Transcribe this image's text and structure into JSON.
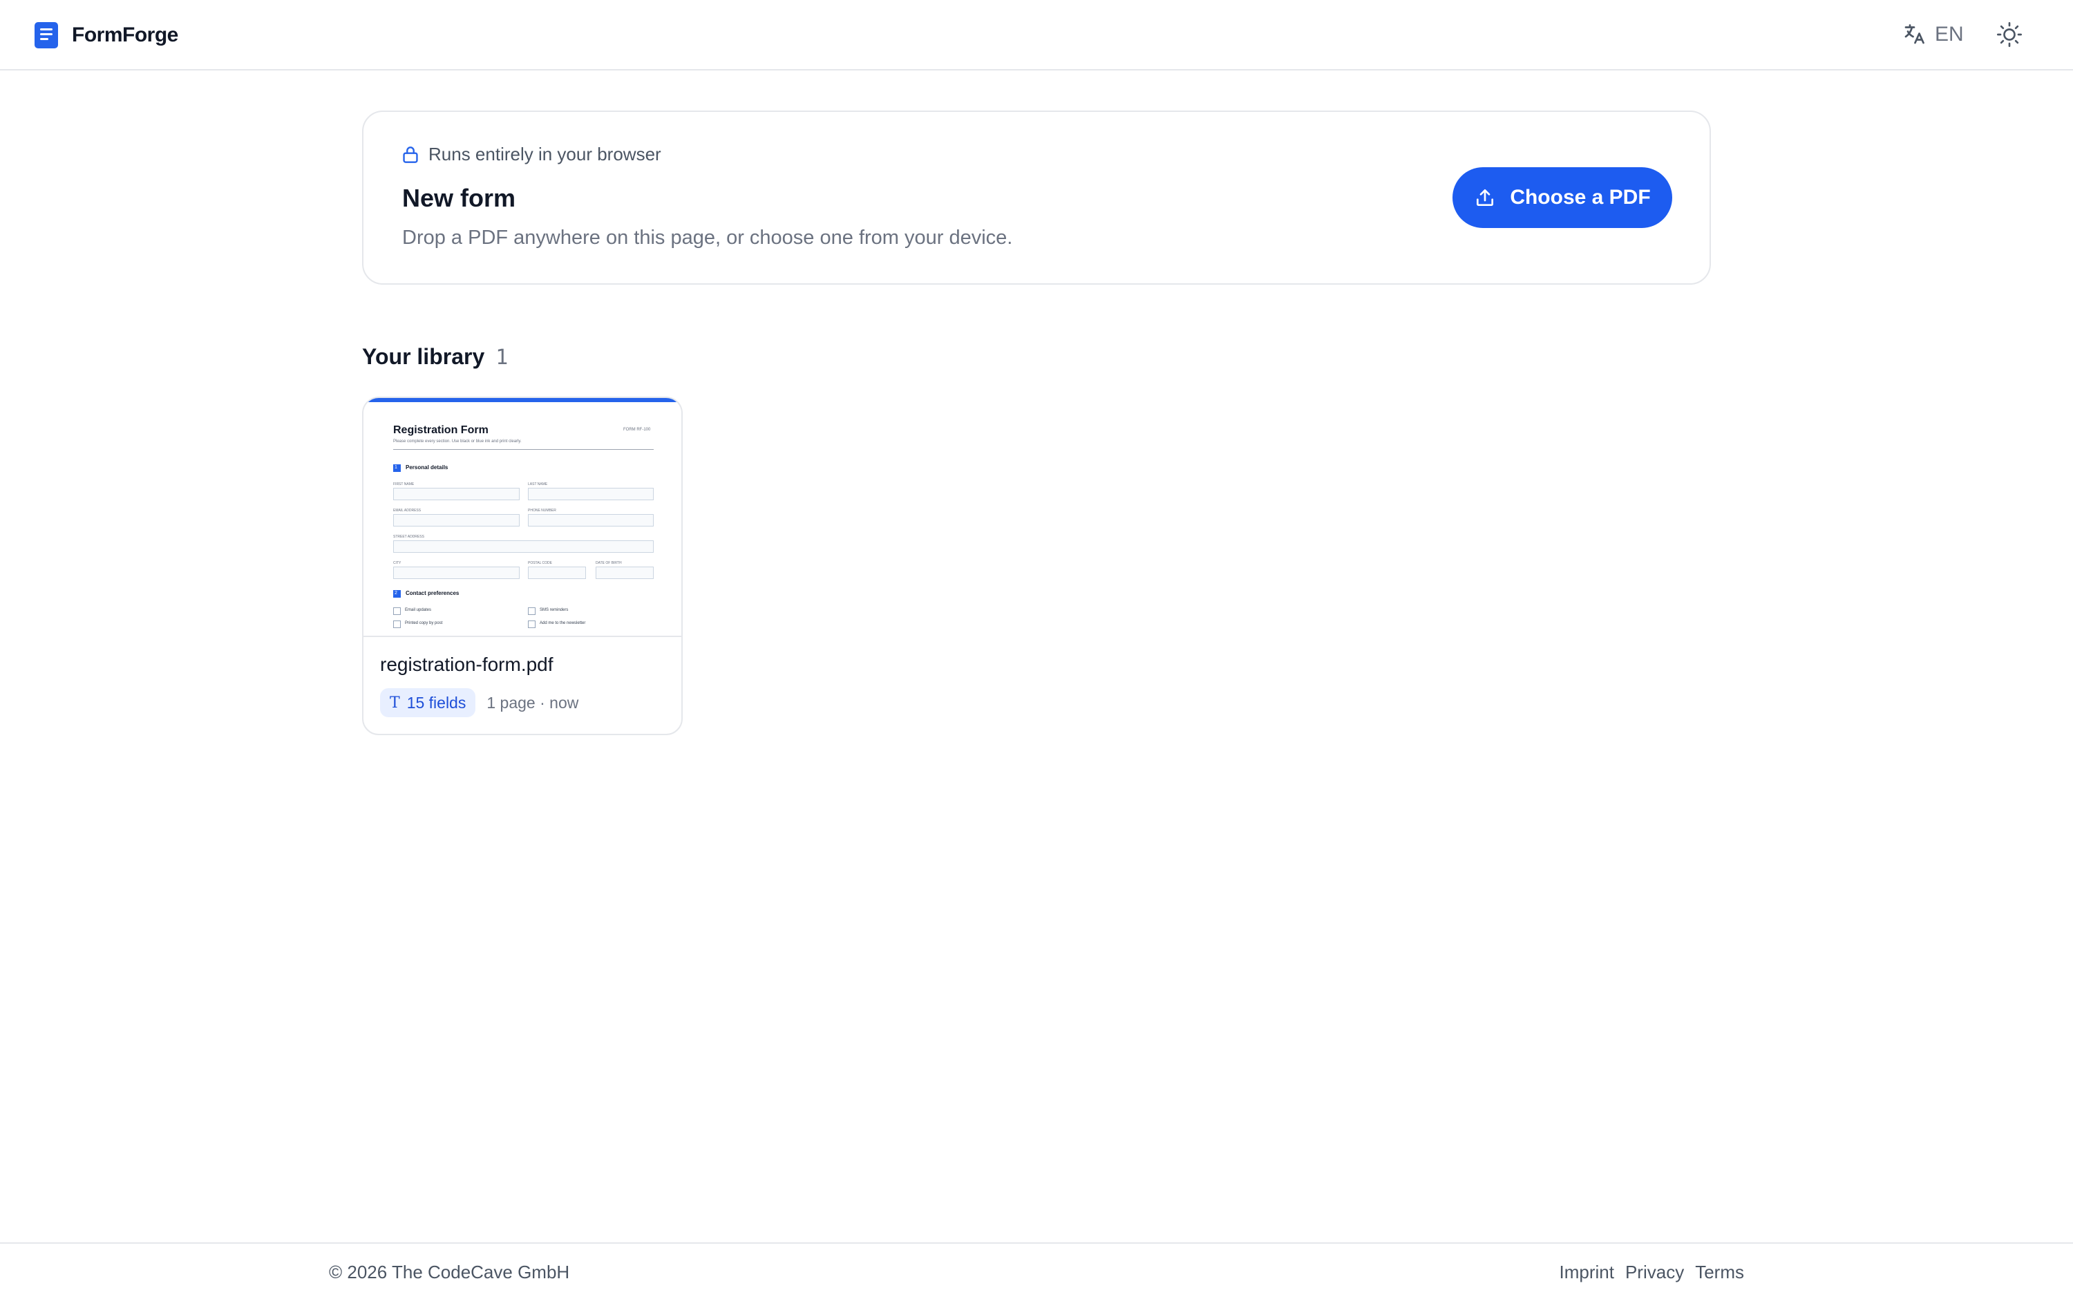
{
  "header": {
    "app_name": "FormForge",
    "language": "EN",
    "icons": {
      "logo": "document-icon",
      "language": "translate-icon",
      "theme": "sun-icon"
    }
  },
  "upload": {
    "privacy_note": "Runs entirely in your browser",
    "title": "New form",
    "description": "Drop a PDF anywhere on this page, or choose one from your device.",
    "button_label": "Choose a PDF",
    "icons": {
      "privacy": "lock-icon",
      "button": "upload-icon"
    }
  },
  "library": {
    "title": "Your library",
    "count": "1",
    "documents": [
      {
        "filename": "registration-form.pdf",
        "fields_badge": "15 fields",
        "meta": "1 page · now",
        "preview": {
          "title": "Registration Form",
          "form_code": "FORM RF-100",
          "subtitle": "Please complete every section. Use black or blue ink and print clearly.",
          "section1": "Personal details",
          "section1_num": "1",
          "first_name": "FIRST NAME",
          "last_name": "LAST NAME",
          "email": "EMAIL ADDRESS",
          "phone": "PHONE NUMBER",
          "street": "STREET ADDRESS",
          "city": "CITY",
          "postal": "POSTAL CODE",
          "dob": "DATE OF BIRTH",
          "section2": "Contact preferences",
          "section2_num": "2",
          "opt1": "Email updates",
          "opt2": "SMS reminders",
          "opt3": "Printed copy by post",
          "opt4": "Add me to the newsletter"
        }
      }
    ]
  },
  "footer": {
    "copyright": "© 2026 The CodeCave GmbH",
    "links": [
      "Imprint",
      "Privacy",
      "Terms"
    ]
  },
  "colors": {
    "accent": "#1d5cf0",
    "badge_bg": "#e8efff",
    "border": "#e5e7eb"
  }
}
